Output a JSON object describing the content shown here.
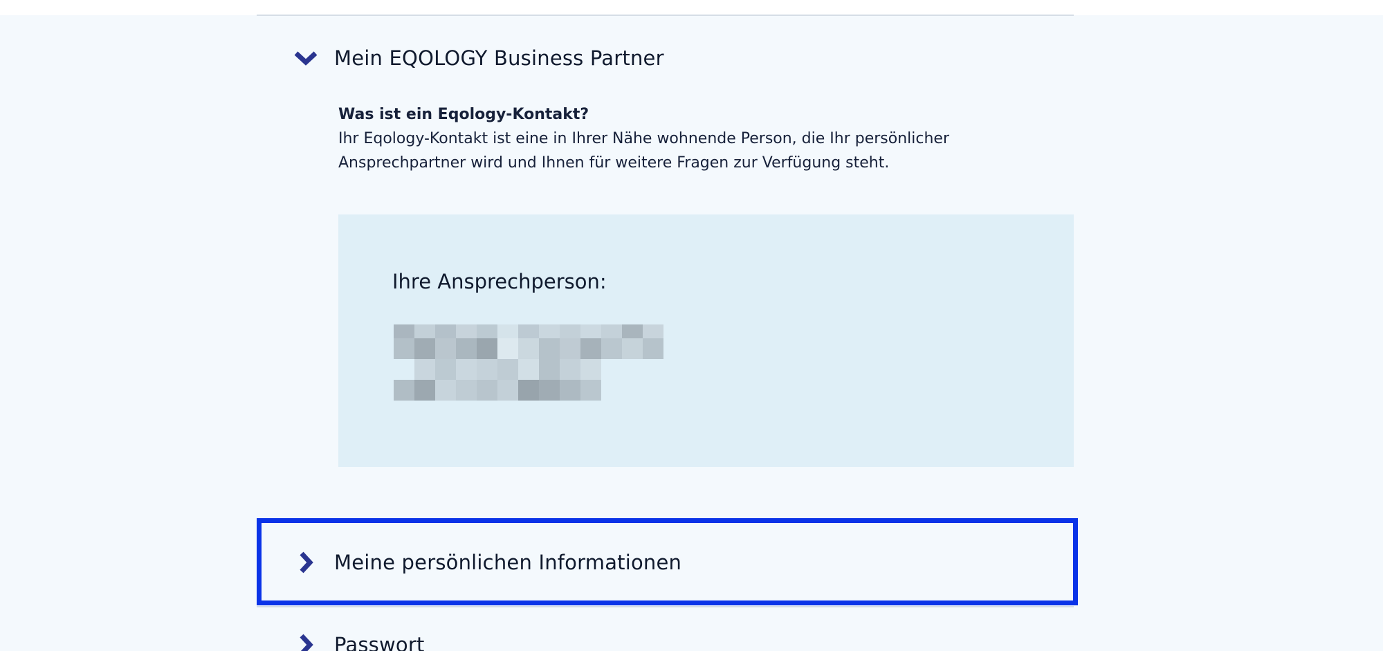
{
  "sections": {
    "partner": {
      "title": "Mein EQOLOGY Business Partner",
      "expanded": true,
      "faq_question": "Was ist ein Eqology-Kontakt?",
      "faq_answer": "Ihr Eqology-Kontakt ist eine in Ihrer Nähe wohnende Person, die Ihr persönlicher Ansprechpartner wird und Ihnen für weitere Fragen zur Verfügung steht.",
      "contact_label": "Ihre Ansprechperson:",
      "contact_details_obscured": true
    },
    "personal": {
      "title": "Meine persönlichen Informationen",
      "expanded": false,
      "highlighted": true
    },
    "password": {
      "title": "Passwort",
      "expanded": false
    }
  },
  "colors": {
    "page_background": "#f4f9fd",
    "accent_chevron": "#2a3590",
    "highlight_border": "#0a33e8",
    "contact_box_background": "#dfeff7"
  },
  "icons": {
    "expanded": "chevron-down-icon",
    "collapsed": "chevron-right-icon"
  }
}
